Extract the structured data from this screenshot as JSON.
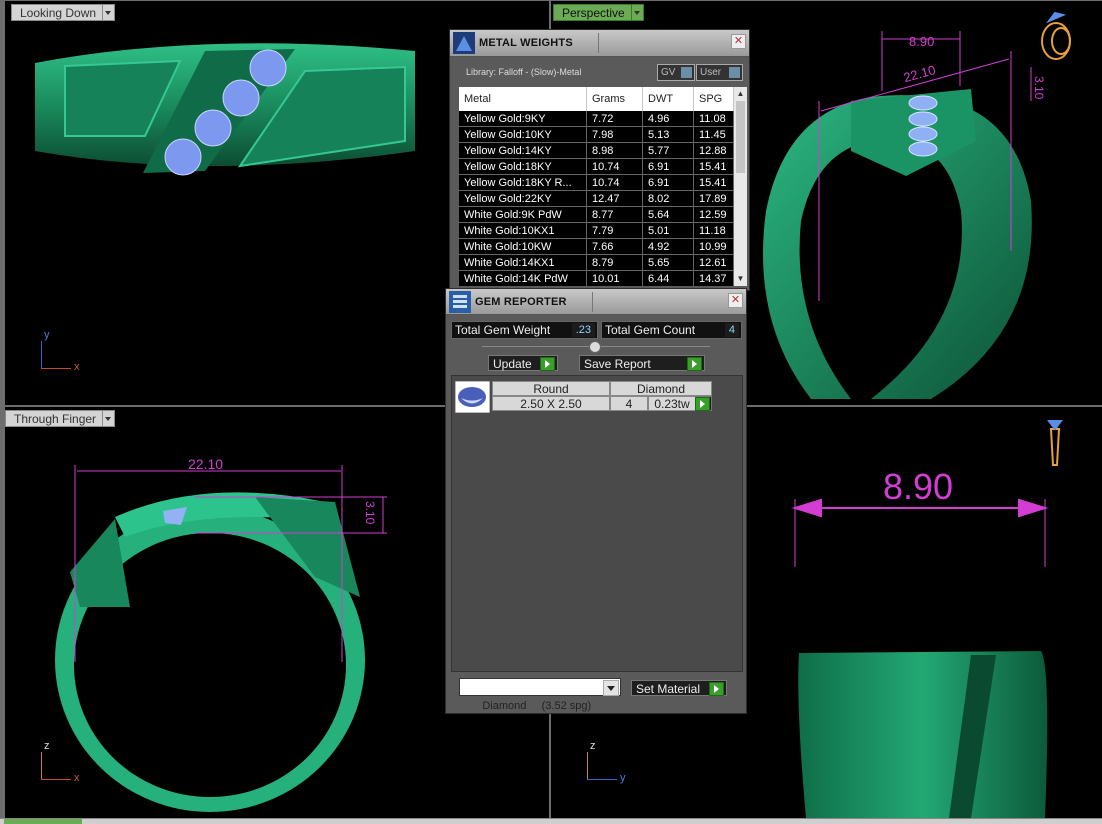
{
  "viewports": {
    "top_left": {
      "label": "Looking Down",
      "axis_y": "y",
      "axis_x": "x"
    },
    "top_right": {
      "label": "Perspective",
      "dim_width": "8.90",
      "dim_length": "22.10",
      "dim_height": "3.10"
    },
    "bottom_left": {
      "label": "Through Finger",
      "dim_length": "22.10",
      "dim_height": "3.10",
      "axis_y": "z",
      "axis_x": "x"
    },
    "bottom_right": {
      "dim_width": "8.90",
      "axis_y": "z",
      "axis_x": "y"
    }
  },
  "metal_weights": {
    "title": "METAL WEIGHTS",
    "library": "Library: Falloff - (Slow)-Metal",
    "toggle_gv": "GV",
    "toggle_user": "User",
    "columns": [
      "Metal",
      "Grams",
      "DWT",
      "SPG"
    ],
    "rows": [
      [
        "Yellow Gold:9KY",
        "7.72",
        "4.96",
        "11.08"
      ],
      [
        "Yellow Gold:10KY",
        "7.98",
        "5.13",
        "11.45"
      ],
      [
        "Yellow Gold:14KY",
        "8.98",
        "5.77",
        "12.88"
      ],
      [
        "Yellow Gold:18KY",
        "10.74",
        "6.91",
        "15.41"
      ],
      [
        "Yellow Gold:18KY R...",
        "10.74",
        "6.91",
        "15.41"
      ],
      [
        "Yellow Gold:22KY",
        "12.47",
        "8.02",
        "17.89"
      ],
      [
        "White Gold:9K PdW",
        "8.77",
        "5.64",
        "12.59"
      ],
      [
        "White Gold:10KX1",
        "7.79",
        "5.01",
        "11.18"
      ],
      [
        "White Gold:10KW",
        "7.66",
        "4.92",
        "10.99"
      ],
      [
        "White Gold:14KX1",
        "8.79",
        "5.65",
        "12.61"
      ],
      [
        "White Gold:14K PdW",
        "10.01",
        "6.44",
        "14.37"
      ]
    ]
  },
  "gem_reporter": {
    "title": "GEM REPORTER",
    "total_weight_label": "Total Gem Weight",
    "total_weight_value": ".23",
    "total_count_label": "Total Gem Count",
    "total_count_value": "4",
    "update_label": "Update",
    "save_report_label": "Save Report",
    "gem": {
      "shape": "Round",
      "type": "Diamond",
      "size": "2.50 X 2.50",
      "count": "4",
      "weight": "0.23tw"
    },
    "material_select": "Diamond     (3.52 spg)",
    "set_material_label": "Set Material"
  },
  "colors": {
    "ring": "#1f9e6e",
    "dimension": "#e040e0",
    "gem": "#8fa8f0",
    "active_tab": "#6aab55"
  }
}
